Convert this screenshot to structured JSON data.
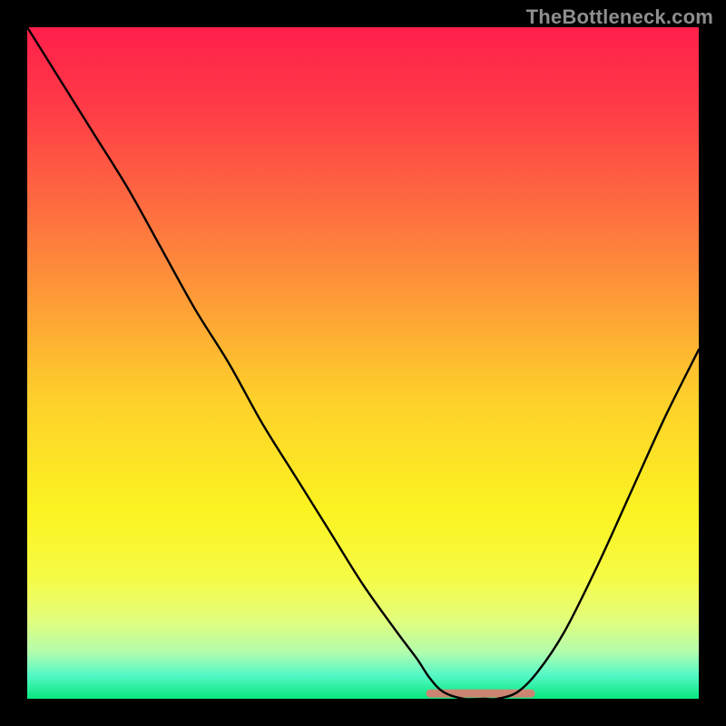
{
  "watermark": "TheBottleneck.com",
  "chart_data": {
    "type": "line",
    "title": "",
    "xlabel": "",
    "ylabel": "",
    "xlim": [
      0,
      100
    ],
    "ylim": [
      0,
      100
    ],
    "grid": false,
    "background": {
      "type": "vertical-gradient",
      "stops": [
        {
          "offset": 0.0,
          "color": "#ff1f4b"
        },
        {
          "offset": 0.12,
          "color": "#ff3b47"
        },
        {
          "offset": 0.35,
          "color": "#fe883c"
        },
        {
          "offset": 0.55,
          "color": "#fecf2b"
        },
        {
          "offset": 0.72,
          "color": "#fbf321"
        },
        {
          "offset": 0.82,
          "color": "#f6fb46"
        },
        {
          "offset": 0.88,
          "color": "#e4fd79"
        },
        {
          "offset": 0.93,
          "color": "#b3fdad"
        },
        {
          "offset": 0.965,
          "color": "#54f8c7"
        },
        {
          "offset": 1.0,
          "color": "#08e77e"
        }
      ]
    },
    "curve": {
      "description": "V-shaped bottleneck curve; y represents mismatch percentage (0 = optimal). Minimum plateau around x ≈ 62–73.",
      "x": [
        0,
        5,
        10,
        15,
        20,
        25,
        30,
        35,
        40,
        45,
        50,
        55,
        58,
        60,
        62,
        65,
        68,
        70,
        73,
        76,
        80,
        85,
        90,
        95,
        100
      ],
      "y": [
        100,
        92,
        84,
        76,
        67,
        58,
        50,
        41,
        33,
        25,
        17,
        10,
        6,
        3,
        1,
        0,
        0,
        0,
        1,
        4,
        10,
        20,
        31,
        42,
        52
      ]
    },
    "optimal_band": {
      "x_start": 60,
      "x_end": 75,
      "y": 0.8,
      "color": "#e07a6f"
    }
  }
}
